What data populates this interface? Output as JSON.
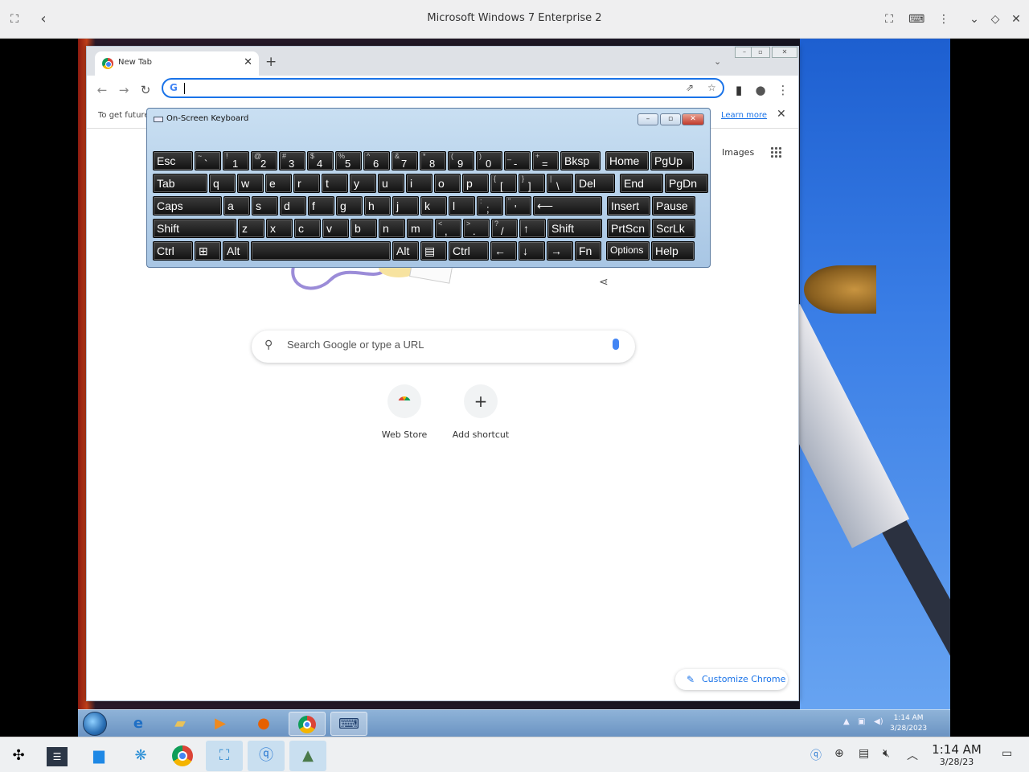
{
  "host": {
    "title": "Microsoft Windows 7 Enterprise 2",
    "clock_time": "1:14 AM",
    "clock_date": "3/28/23"
  },
  "chrome": {
    "tab_title": "New Tab",
    "omnibox_value": "",
    "omnibox_g": "G",
    "infobar_message": "To get future",
    "infobar_link": "Learn more",
    "images_link": "Images",
    "search_placeholder": "Search Google or type a URL",
    "shortcuts": [
      "Web Store",
      "Add shortcut"
    ],
    "customize_label": "Customize Chrome"
  },
  "osk": {
    "title": "On-Screen Keyboard",
    "rows": [
      [
        {
          "label": "Esc"
        },
        {
          "label": "`",
          "shift": "~"
        },
        {
          "label": "1",
          "shift": "!"
        },
        {
          "label": "2",
          "shift": "@"
        },
        {
          "label": "3",
          "shift": "#"
        },
        {
          "label": "4",
          "shift": "$"
        },
        {
          "label": "5",
          "shift": "%"
        },
        {
          "label": "6",
          "shift": "^"
        },
        {
          "label": "7",
          "shift": "&"
        },
        {
          "label": "8",
          "shift": "*"
        },
        {
          "label": "9",
          "shift": "("
        },
        {
          "label": "0",
          "shift": ")"
        },
        {
          "label": "-",
          "shift": "_"
        },
        {
          "label": "=",
          "shift": "+"
        },
        {
          "label": "Bksp"
        },
        {
          "label": "Home"
        },
        {
          "label": "PgUp"
        }
      ],
      [
        {
          "label": "Tab"
        },
        {
          "label": "q"
        },
        {
          "label": "w"
        },
        {
          "label": "e"
        },
        {
          "label": "r"
        },
        {
          "label": "t"
        },
        {
          "label": "y"
        },
        {
          "label": "u"
        },
        {
          "label": "i"
        },
        {
          "label": "o"
        },
        {
          "label": "p"
        },
        {
          "label": "[",
          "shift": "{"
        },
        {
          "label": "]",
          "shift": "}"
        },
        {
          "label": "\\",
          "shift": "|"
        },
        {
          "label": "Del"
        },
        {
          "label": "End"
        },
        {
          "label": "PgDn"
        }
      ],
      [
        {
          "label": "Caps"
        },
        {
          "label": "a"
        },
        {
          "label": "s"
        },
        {
          "label": "d"
        },
        {
          "label": "f"
        },
        {
          "label": "g"
        },
        {
          "label": "h"
        },
        {
          "label": "j"
        },
        {
          "label": "k"
        },
        {
          "label": "l"
        },
        {
          "label": ";",
          "shift": ":"
        },
        {
          "label": "'",
          "shift": "\""
        },
        {
          "label": "⟵"
        },
        {
          "label": "Insert"
        },
        {
          "label": "Pause"
        }
      ],
      [
        {
          "label": "Shift"
        },
        {
          "label": "z"
        },
        {
          "label": "x"
        },
        {
          "label": "c"
        },
        {
          "label": "v"
        },
        {
          "label": "b"
        },
        {
          "label": "n"
        },
        {
          "label": "m"
        },
        {
          "label": ",",
          "shift": "<"
        },
        {
          "label": ".",
          "shift": ">"
        },
        {
          "label": "/",
          "shift": "?"
        },
        {
          "label": "↑"
        },
        {
          "label": "Shift"
        },
        {
          "label": "PrtScn"
        },
        {
          "label": "ScrLk"
        }
      ],
      [
        {
          "label": "Ctrl"
        },
        {
          "label": "⊞"
        },
        {
          "label": "Alt"
        },
        {
          "label": ""
        },
        {
          "label": "Alt"
        },
        {
          "label": "▤"
        },
        {
          "label": "Ctrl"
        },
        {
          "label": "←"
        },
        {
          "label": "↓"
        },
        {
          "label": "→"
        },
        {
          "label": "Fn"
        },
        {
          "label": "Options"
        },
        {
          "label": "Help"
        }
      ]
    ]
  },
  "win7": {
    "tray_time": "1:14 AM",
    "tray_date": "3/28/2023"
  }
}
